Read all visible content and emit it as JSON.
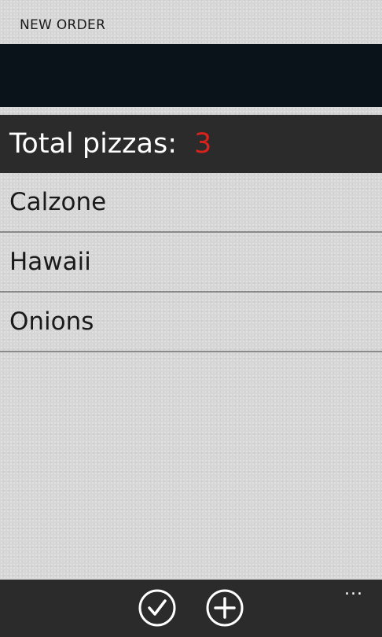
{
  "app_title": "NEW ORDER",
  "summary": {
    "label": "Total pizzas:",
    "count": "3"
  },
  "pizzas": [
    {
      "name": "Calzone"
    },
    {
      "name": "Hawaii"
    },
    {
      "name": "Onions"
    }
  ],
  "app_bar": {
    "buttons": [
      {
        "icon": "check-icon"
      },
      {
        "icon": "add-icon"
      }
    ],
    "more": "..."
  },
  "colors": {
    "background": "#d6d6d6",
    "header": "#0b131a",
    "bar": "#2b2b2b",
    "accent": "#d8231d"
  }
}
